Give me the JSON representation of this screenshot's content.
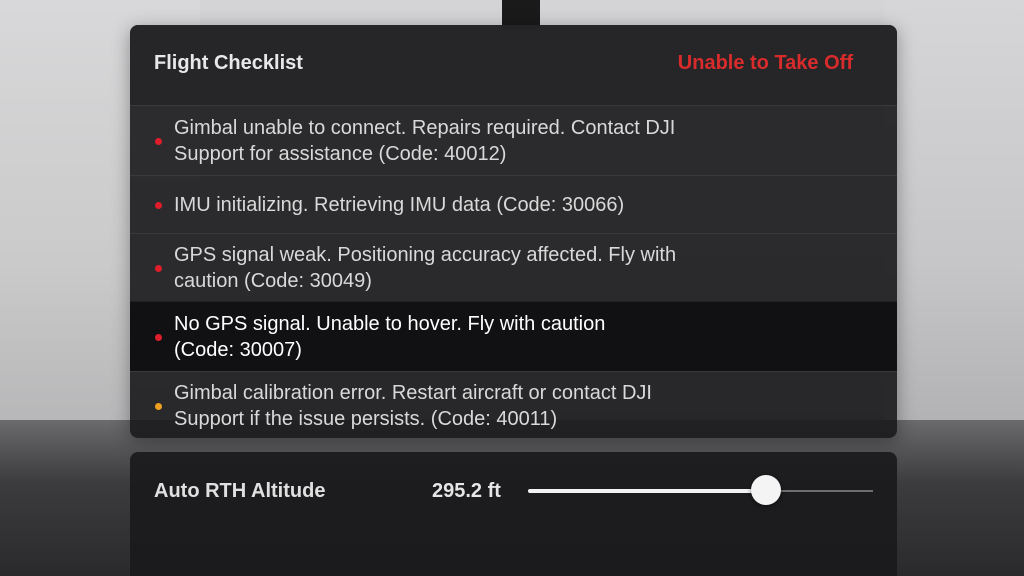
{
  "checklist": {
    "title": "Flight Checklist",
    "status": "Unable to Take Off",
    "items": [
      {
        "message": "Gimbal unable to connect. Repairs required. Contact DJI\nSupport for assistance (Code: 40012)",
        "severity": "error",
        "dot_color": "#e01d2b"
      },
      {
        "message": "IMU initializing. Retrieving IMU data (Code: 30066)",
        "severity": "error",
        "dot_color": "#e01d2b"
      },
      {
        "message": "GPS signal weak. Positioning accuracy affected. Fly with\ncaution (Code: 30049)",
        "severity": "error",
        "dot_color": "#e01d2b"
      },
      {
        "message": "No GPS signal. Unable to hover. Fly with caution\n(Code: 30007)",
        "severity": "error",
        "dot_color": "#e01d2b"
      },
      {
        "message": "Gimbal calibration error. Restart aircraft or contact DJI\nSupport if the issue persists. (Code: 40011)",
        "severity": "warning",
        "dot_color": "#f0a020"
      }
    ]
  },
  "rth": {
    "label": "Auto RTH Altitude",
    "value": "295.2 ft",
    "slider_fraction": 0.69
  },
  "colors": {
    "error": "#e01d2b",
    "warning": "#f0a020",
    "status_red": "#d92b2b"
  }
}
